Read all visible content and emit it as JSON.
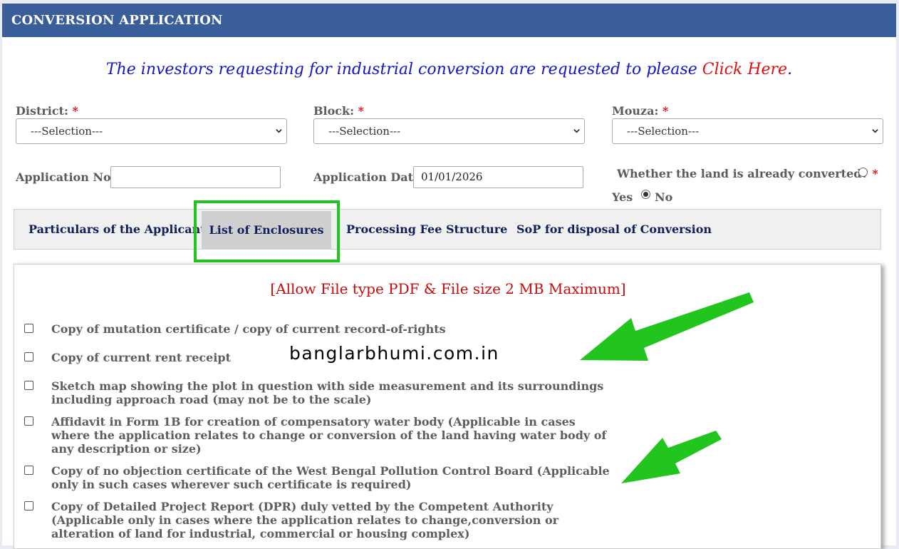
{
  "header": {
    "title": "CONVERSION APPLICATION"
  },
  "notice": {
    "text": "The investors requesting for industrial conversion are requested to please",
    "link": "Click Here",
    "end": "."
  },
  "form": {
    "district_label": "District:",
    "block_label": "Block:",
    "mouza_label": "Mouza:",
    "required_mark": "*",
    "select_placeholder": "---Selection---",
    "app_no_label": "Application No",
    "app_no_value": "",
    "app_date_label": "Application Date",
    "app_date_value": "01/01/2026",
    "converted_question": "Whether the land is already converted?",
    "yes_label": "Yes",
    "no_label": "No",
    "converted_selected": "No"
  },
  "tabs": [
    {
      "label": "Particulars of the Applicant"
    },
    {
      "label": "List of Enclosures",
      "active": true
    },
    {
      "label": "Processing Fee Structure"
    },
    {
      "label": "SoP for disposal of Conversion"
    }
  ],
  "enclosures": {
    "notice": "[Allow File type PDF & File size 2 MB Maximum]",
    "items": [
      "Copy of mutation certificate / copy of current record-of-rights",
      "Copy of current rent receipt",
      "Sketch map showing the plot in question with side measurement and its surroundings including approach road (may not be to the scale)",
      "Affidavit in Form 1B for creation of compensatory water body (Applicable in cases where the application relates to change or conversion of the land having water body of any description or size)",
      "Copy of no objection certificate of the West Bengal Pollution Control Board (Applicable only in such cases wherever such certificate is required)",
      "Copy of Detailed Project Report (DPR) duly vetted by the Competent Authority (Applicable only in cases where the application relates to change,conversion or alteration of land for industrial, commercial or housing complex)"
    ]
  },
  "watermark": "banglarbhumi.com.in",
  "colors": {
    "header_bg": "#3a5e9a",
    "highlight": "#22c51e",
    "notice_link": "#e01010",
    "notice_text": "#1515c8"
  }
}
